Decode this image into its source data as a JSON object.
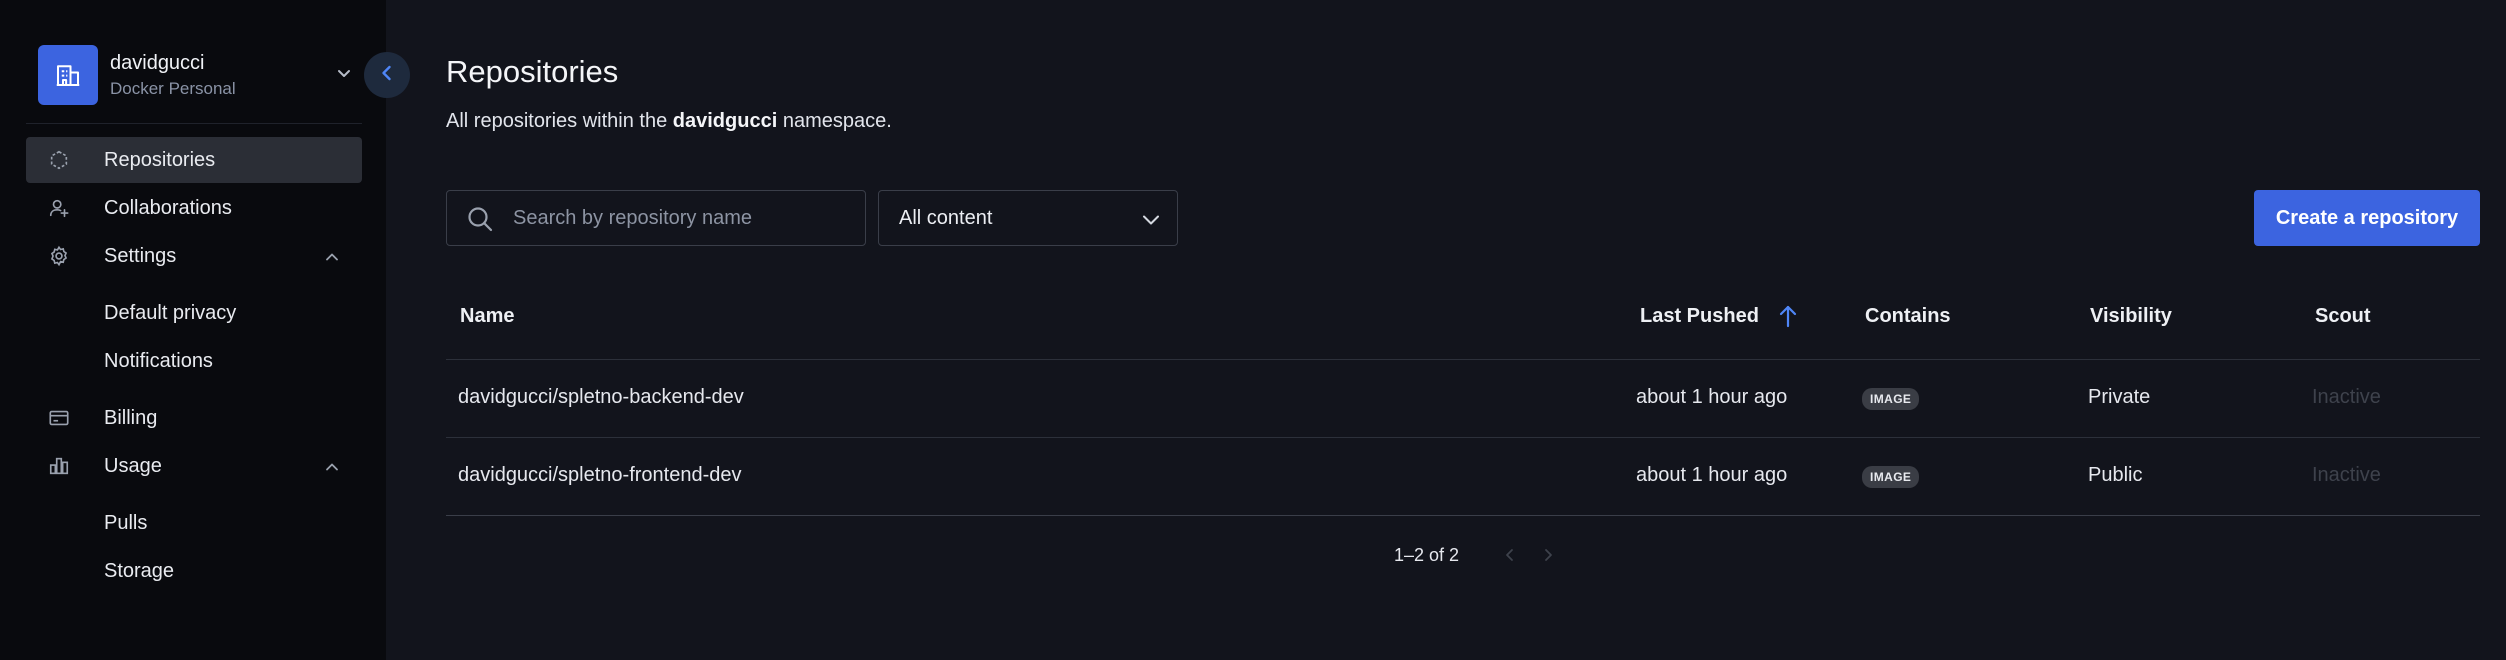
{
  "colors": {
    "accent": "#3c64e0",
    "sidebar_bg": "#090a0e",
    "main_bg": "#12141c",
    "active_nav_bg": "#2b2e36"
  },
  "org": {
    "name": "davidgucci",
    "subtitle": "Docker Personal",
    "icon": "building-icon"
  },
  "sidebar": {
    "items": [
      {
        "label": "Repositories",
        "icon": "repository-icon",
        "active": true
      },
      {
        "label": "Collaborations",
        "icon": "collaborators-icon"
      },
      {
        "label": "Settings",
        "icon": "gear-icon",
        "expanded": true,
        "children": [
          "Default privacy",
          "Notifications"
        ]
      },
      {
        "label": "Billing",
        "icon": "credit-card-icon"
      },
      {
        "label": "Usage",
        "icon": "bar-chart-icon",
        "expanded": true,
        "children": [
          "Pulls",
          "Storage"
        ]
      }
    ]
  },
  "header": {
    "title": "Repositories",
    "description_prefix": "All repositories within the ",
    "namespace": "davidgucci",
    "description_suffix": " namespace."
  },
  "toolbar": {
    "search_placeholder": "Search by repository name",
    "filter_value": "All content",
    "create_label": "Create a repository"
  },
  "table": {
    "columns": [
      "Name",
      "Last Pushed",
      "Contains",
      "Visibility",
      "Scout"
    ],
    "sort_column": "Last Pushed",
    "rows": [
      {
        "name": "davidgucci/spletno-backend-dev",
        "last_pushed": "about 1 hour ago",
        "contains": "IMAGE",
        "visibility": "Private",
        "scout": "Inactive"
      },
      {
        "name": "davidgucci/spletno-frontend-dev",
        "last_pushed": "about 1 hour ago",
        "contains": "IMAGE",
        "visibility": "Public",
        "scout": "Inactive"
      }
    ]
  },
  "pagination": {
    "text": "1–2 of 2"
  }
}
